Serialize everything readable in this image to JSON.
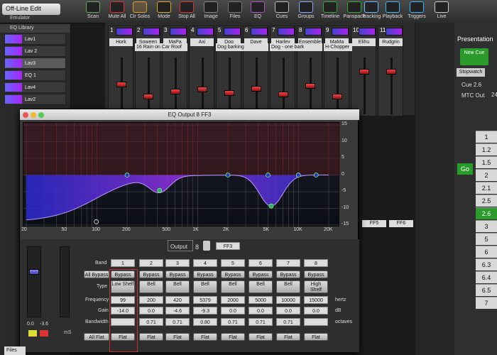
{
  "toolbar": {
    "mode": "Off-Line Edit",
    "mode_sub": "Emulator",
    "buttons": [
      "Scan",
      "Mute All",
      "Clr Solos",
      "Mode",
      "Stop All",
      "Image",
      "Files",
      "EQ",
      "Cues",
      "Groups",
      "Timeline",
      "Panspace",
      "Tracking",
      "Playback",
      "Triggers",
      "Live"
    ]
  },
  "eqlib": {
    "title": "EQ Library",
    "items": [
      "Lav1",
      "Lav 2",
      "Lav3",
      "EQ 1",
      "Lav4",
      "Lav2"
    ]
  },
  "channels": [
    {
      "num": "1",
      "name": "Hork"
    },
    {
      "num": "2",
      "name": "Soween"
    },
    {
      "num": "3",
      "name": "MaPa"
    },
    {
      "num": "4",
      "name": "Axi"
    },
    {
      "num": "5",
      "name": "Dog"
    },
    {
      "num": "6",
      "name": "Dave"
    },
    {
      "num": "7",
      "name": "Harley"
    },
    {
      "num": "8",
      "name": "Ensemble"
    },
    {
      "num": "9",
      "name": "MaMa"
    },
    {
      "num": "10",
      "name": "Elihu"
    },
    {
      "num": "11",
      "name": "Rudgrin"
    }
  ],
  "cue_texts": [
    "16 Rain on Car Roof",
    "Dog barking",
    "Dog - one bark",
    "H-Chopper"
  ],
  "eqwin": {
    "title": "EQ Output 8 FF3",
    "output_label": "Output",
    "output_num": "8",
    "output_name": "FF3"
  },
  "xticks": [
    "20",
    "50",
    "100",
    "200",
    "500",
    "1K",
    "2K",
    "5K",
    "10K",
    "20K"
  ],
  "yticks": [
    "15",
    "10",
    "5",
    "0",
    "-5",
    "-10",
    "-15"
  ],
  "panel": {
    "row_labels": {
      "band": "Band",
      "type": "Type",
      "frequency": "Frequency",
      "gain": "Gain",
      "bandwidth": "Bandwidth"
    },
    "all_bypass": "All Bypass",
    "all_flat": "All Flat",
    "units": {
      "freq": "hertz",
      "gain": "dB",
      "bw": "octaves"
    },
    "bands": [
      {
        "n": "1",
        "bypass": "Bypass",
        "type": "Low Shelf",
        "freq": "99",
        "gain": "-14.0",
        "bw": "",
        "flat": "Flat"
      },
      {
        "n": "2",
        "bypass": "Bypass",
        "type": "Bell",
        "freq": "200",
        "gain": "0.0",
        "bw": "0.71",
        "flat": "Flat"
      },
      {
        "n": "3",
        "bypass": "Bypass",
        "type": "Bell",
        "freq": "420",
        "gain": "-4.6",
        "bw": "0.71",
        "flat": "Flat"
      },
      {
        "n": "4",
        "bypass": "Bypass",
        "type": "Bell",
        "freq": "5379",
        "gain": "-9.3",
        "bw": "0.80",
        "flat": "Flat"
      },
      {
        "n": "5",
        "bypass": "Bypass",
        "type": "Bell",
        "freq": "2000",
        "gain": "0.0",
        "bw": "0.71",
        "flat": "Flat"
      },
      {
        "n": "6",
        "bypass": "Bypass",
        "type": "Bell",
        "freq": "5000",
        "gain": "0.0",
        "bw": "0.71",
        "flat": "Flat"
      },
      {
        "n": "7",
        "bypass": "Bypass",
        "type": "Bell",
        "freq": "10000",
        "gain": "0.0",
        "bw": "0.71",
        "flat": "Flat"
      },
      {
        "n": "8",
        "bypass": "Bypass",
        "type": "High Shelf",
        "freq": "15000",
        "gain": "0.0",
        "bw": "",
        "flat": "Flat"
      }
    ]
  },
  "left_meter": {
    "v1": "0.0",
    "v2": "-3.6",
    "ms": "mS"
  },
  "present": {
    "title": "Presentation",
    "new_cue": "New Cue",
    "stopwatch": "Stopwatch",
    "cue": "Cue 2.6",
    "mtc": "MTC Out",
    "mtc_val": "24",
    "go": "Go",
    "cues": [
      "1",
      "1.2",
      "1.5",
      "2",
      "2.1",
      "2.5",
      "2.6",
      "3",
      "5",
      "6",
      "6.3",
      "6.4",
      "6.5",
      "7"
    ]
  },
  "files_tab": "Files"
}
